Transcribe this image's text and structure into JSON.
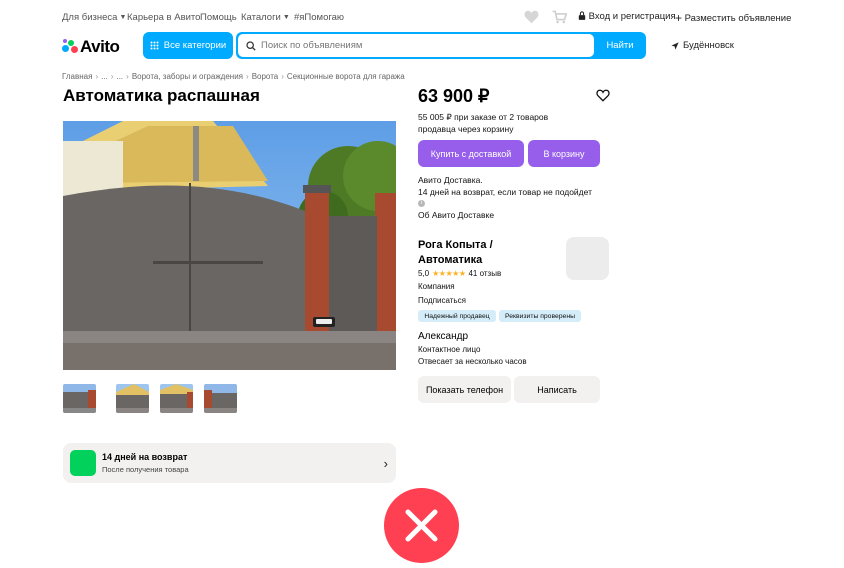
{
  "topnav": {
    "business": "Для бизнеса",
    "career": "Карьера в Авито",
    "help": "Помощь",
    "catalogs": "Каталоги",
    "ya_pomogayu": "#яПомогаю",
    "login": "Вход и регистрация",
    "post_ad": "Разместить объявление"
  },
  "header": {
    "logo": "Avito",
    "categories_btn": "Все категории",
    "search_placeholder": "Поиск по объявлениям",
    "search_btn": "Найти",
    "location": "Будённовск"
  },
  "breadcrumbs": [
    "Главная",
    "...",
    "...",
    "Ворота, заборы и ограждения",
    "Ворота",
    "Секционные ворота для гаража"
  ],
  "listing": {
    "title": "Автоматика распашная",
    "price": "63 900 ₽",
    "bulk_note_line1": "55 005 ₽ при заказе от 2 товаров",
    "bulk_note_line2": "продавца через корзину",
    "buy_btn": "Купить с доставкой",
    "cart_btn": "В корзину",
    "delivery_line1": "Авито Доставка.",
    "delivery_line2": "14 дней на возврат, если товар не подойдет",
    "delivery_link": "Об Авито Доставке"
  },
  "seller": {
    "name_line1": "Рога Копыта /",
    "name_line2": "Автоматика",
    "rating": "5,0",
    "stars": "★★★★★",
    "reviews": "41 отзыв",
    "type": "Компания",
    "subscribe": "Подписаться",
    "badges": [
      "Надежный продавец",
      "Реквизиты проверены"
    ]
  },
  "contact": {
    "name": "Александр",
    "role": "Контактное лицо",
    "response": "Отвесает за несколько часов",
    "phone_btn": "Показать телефон",
    "write_btn": "Написать"
  },
  "return_banner": {
    "title": "14 дней на возврат",
    "subtitle": "После получения товара"
  },
  "colors": {
    "accent_blue": "#00aaff",
    "purple": "#965eeb",
    "link": "#0099f7",
    "green": "#02d15c",
    "close_red": "#ff4053"
  }
}
